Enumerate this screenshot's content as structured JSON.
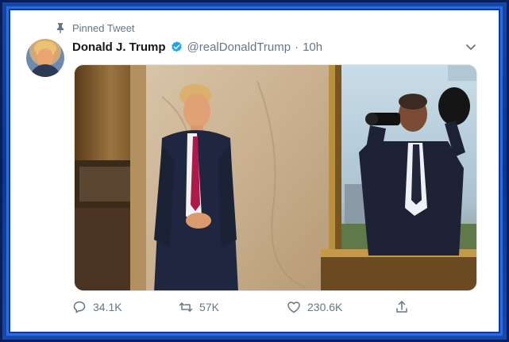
{
  "tweet": {
    "pinned_label": "Pinned Tweet",
    "display_name": "Donald J. Trump",
    "handle": "@realDonaldTrump",
    "separator": "·",
    "timestamp": "10h",
    "verified": true,
    "avatar_alt": "profile photo"
  },
  "actions": {
    "replies": "34.1K",
    "retweets": "57K",
    "likes": "230.6K"
  },
  "icons": {
    "pin": "pin-icon",
    "verified": "verified-badge-icon",
    "more": "chevron-down-icon",
    "reply": "reply-icon",
    "retweet": "retweet-icon",
    "like": "heart-icon",
    "share": "share-icon"
  },
  "colors": {
    "frame_blue": "#0b3590",
    "twitter_blue": "#1da1f2",
    "secondary_text": "#657786",
    "primary_text": "#14171a"
  }
}
